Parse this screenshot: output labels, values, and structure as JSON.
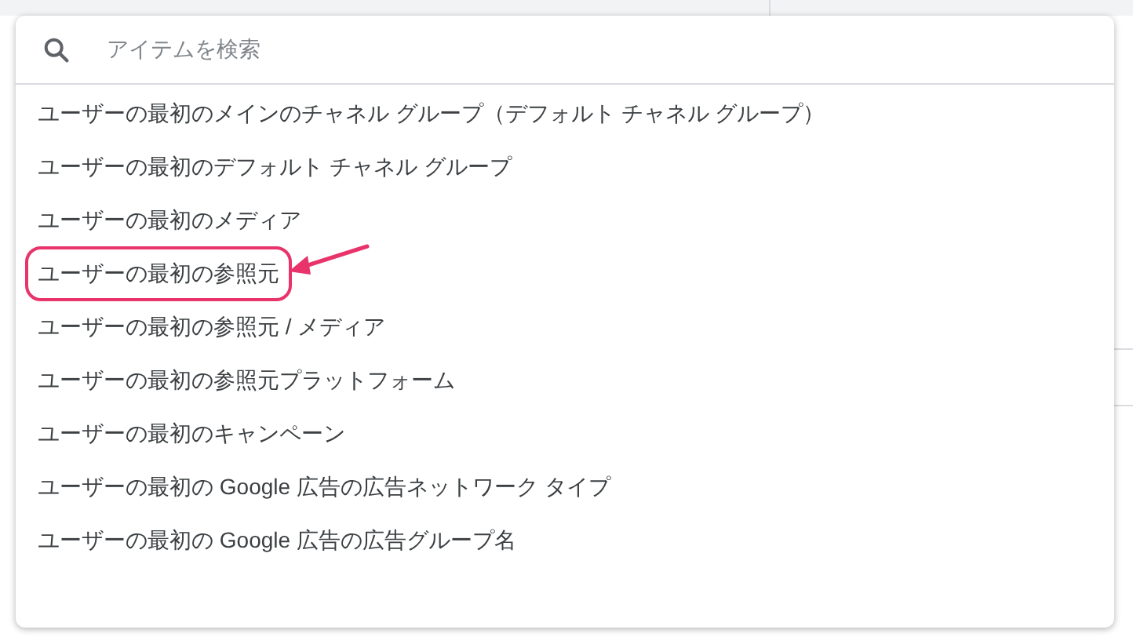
{
  "search": {
    "placeholder": "アイテムを検索"
  },
  "items": [
    {
      "label": "ユーザーの最初のメインのチャネル グループ（デフォルト チャネル グループ）",
      "circled": false
    },
    {
      "label": "ユーザーの最初のデフォルト チャネル グループ",
      "circled": false
    },
    {
      "label": "ユーザーの最初のメディア",
      "circled": false
    },
    {
      "label": "ユーザーの最初の参照元",
      "circled": true
    },
    {
      "label": "ユーザーの最初の参照元 / メディア",
      "circled": false
    },
    {
      "label": "ユーザーの最初の参照元プラットフォーム",
      "circled": false
    },
    {
      "label": "ユーザーの最初のキャンペーン",
      "circled": false
    },
    {
      "label": "ユーザーの最初の Google 広告の広告ネットワーク タイプ",
      "circled": false
    },
    {
      "label": "ユーザーの最初の Google 広告の広告グループ名",
      "circled": false
    }
  ]
}
